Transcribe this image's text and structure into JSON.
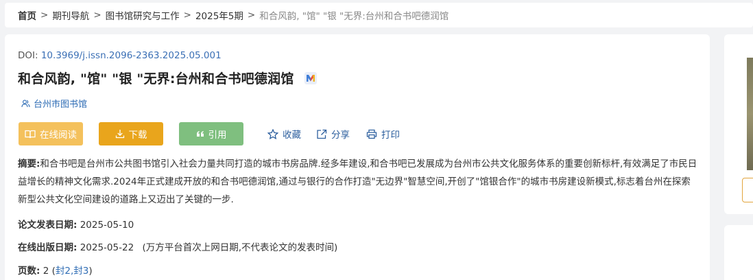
{
  "breadcrumb": {
    "home": "首页",
    "items": [
      "期刊导航",
      "图书馆研究与工作",
      "2025年5期"
    ],
    "current": "和合风韵, \"馆\" \"银 \"无界:台州和合书吧德润馆",
    "separator": ">"
  },
  "article": {
    "doi_label": "DOI: ",
    "doi_value": "10.3969/j.issn.2096-2363.2025.05.001",
    "title": "和合风韵, \"馆\" \"银 \"无界:台州和合书吧德润馆",
    "author": "台州市图书馆"
  },
  "actions": {
    "read_online": "在线阅读",
    "download": "下载",
    "cite": "引用",
    "favorite": "收藏",
    "share": "分享",
    "print": "打印"
  },
  "abstract": {
    "label": "摘要:",
    "text": "和合书吧是台州市公共图书馆引入社会力量共同打造的城市书房品牌.经多年建设,和合书吧已发展成为台州市公共文化服务体系的重要创新标杆,有效满足了市民日益增长的精神文化需求.2024年正式建成开放的和合书吧德润馆,通过与银行的合作打造\"无边界\"智慧空间,开创了\"馆银合作\"的城市书房建设新模式,标志着台州在探索新型公共文化空间建设的道路上又迈出了关键的一步."
  },
  "meta": {
    "pub_date_label": "论文发表日期:",
    "pub_date": "2025-05-10",
    "online_date_label": "在线出版日期:",
    "online_date": "2025-05-22",
    "online_date_note": "(万方平台首次上网日期,不代表论文的发表时间)",
    "pages_label": "页数:",
    "pages": "2",
    "page_refs_open": "(",
    "page_refs": "封2,封3",
    "page_refs_close": ")"
  },
  "colors": {
    "link_blue": "#2f6db5",
    "read_btn": "#f4c15c",
    "download_btn": "#e9a51c",
    "cite_btn": "#7fbf7f"
  },
  "icons": [
    "book-icon",
    "download-icon",
    "quote-icon",
    "star-icon",
    "share-icon",
    "printer-icon",
    "user-icon",
    "m-badge-icon"
  ]
}
